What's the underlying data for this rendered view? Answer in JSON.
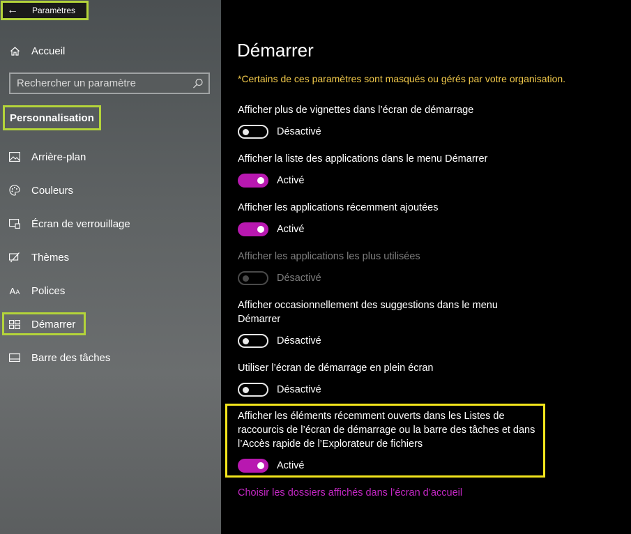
{
  "titlebar": {
    "back_icon": "arrow-left-icon",
    "title": "Paramètres"
  },
  "sidebar": {
    "home_label": "Accueil",
    "search_placeholder": "Rechercher un paramètre",
    "section_title": "Personnalisation",
    "items": [
      {
        "label": "Arrière-plan",
        "icon": "picture-icon"
      },
      {
        "label": "Couleurs",
        "icon": "palette-icon"
      },
      {
        "label": "Écran de verrouillage",
        "icon": "lock-screen-icon"
      },
      {
        "label": "Thèmes",
        "icon": "theme-brush-icon"
      },
      {
        "label": "Polices",
        "icon": "font-icon"
      },
      {
        "label": "Démarrer",
        "icon": "start-tiles-icon",
        "active": true
      },
      {
        "label": "Barre des tâches",
        "icon": "taskbar-icon"
      }
    ]
  },
  "main": {
    "title": "Démarrer",
    "notice": "*Certains de ces paramètres sont masqués ou gérés par votre organisation.",
    "settings": [
      {
        "label": "Afficher plus de vignettes dans l’écran de démarrage",
        "state": "Désactivé",
        "on": false,
        "disabled": false
      },
      {
        "label": "Afficher la liste des applications dans le menu Démarrer",
        "state": "Activé",
        "on": true,
        "disabled": false
      },
      {
        "label": "Afficher les applications récemment ajoutées",
        "state": "Activé",
        "on": true,
        "disabled": false
      },
      {
        "label": "Afficher les applications les plus utilisées",
        "state": "Désactivé",
        "on": false,
        "disabled": true
      },
      {
        "label": "Afficher occasionnellement des suggestions dans le menu Démarrer",
        "state": "Désactivé",
        "on": false,
        "disabled": false
      },
      {
        "label": "Utiliser l’écran de démarrage en plein écran",
        "state": "Désactivé",
        "on": false,
        "disabled": false
      },
      {
        "label": "Afficher les éléments récemment ouverts dans les Listes de raccourcis de l’écran de démarrage ou la barre des tâches et dans l’Accès rapide de l’Explorateur de fichiers",
        "state": "Activé",
        "on": true,
        "disabled": false
      }
    ],
    "link": "Choisir les dossiers affichés dans l’écran d’accueil"
  },
  "colors": {
    "accent": "#b818b0",
    "link": "#c427c4",
    "notice": "#f0c84a",
    "highlight_green": "#b4d43a",
    "highlight_yellow": "#f2e51c"
  }
}
